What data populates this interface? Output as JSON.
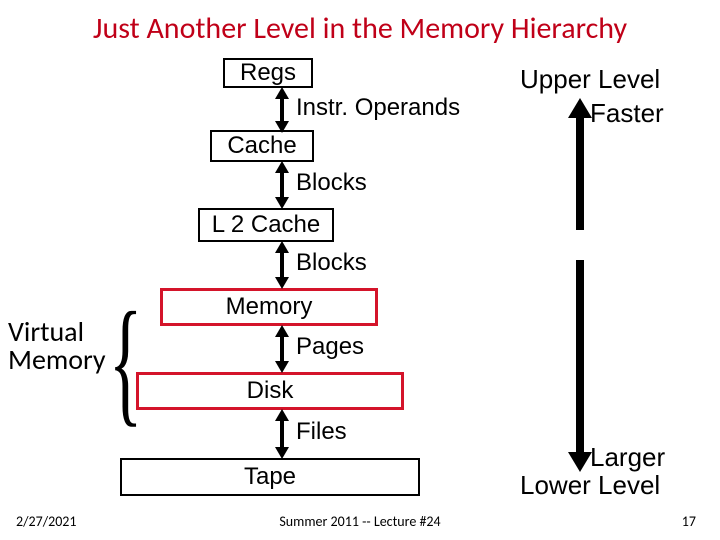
{
  "title": "Just Another Level in the Memory Hierarchy",
  "levels": {
    "regs": "Regs",
    "cache": "Cache",
    "l2cache": "L 2 Cache",
    "memory": "Memory",
    "disk": "Disk",
    "tape": "Tape"
  },
  "transfers": {
    "regs_cache": "Instr. Operands",
    "cache_l2": "Blocks",
    "l2_mem": "Blocks",
    "mem_disk": "Pages",
    "disk_tape": "Files"
  },
  "annotations": {
    "vm": "Virtual\nMemory",
    "upper": "Upper Level",
    "faster": "Faster",
    "larger": "Larger",
    "lower": "Lower Level"
  },
  "footer": {
    "date": "2/27/2021",
    "center": "Summer 2011 -- Lecture #24",
    "slide": "17"
  },
  "chart_data": {
    "type": "diagram",
    "hierarchy": [
      {
        "level": "Regs",
        "transfer_unit_down": "Instr. Operands"
      },
      {
        "level": "Cache",
        "transfer_unit_down": "Blocks"
      },
      {
        "level": "L 2 Cache",
        "transfer_unit_down": "Blocks"
      },
      {
        "level": "Memory",
        "transfer_unit_down": "Pages"
      },
      {
        "level": "Disk",
        "transfer_unit_down": "Files"
      },
      {
        "level": "Tape",
        "transfer_unit_down": null
      }
    ],
    "virtual_memory_spans": [
      "Memory",
      "Disk"
    ],
    "axes": {
      "upper": "Faster",
      "lower": "Larger"
    }
  }
}
